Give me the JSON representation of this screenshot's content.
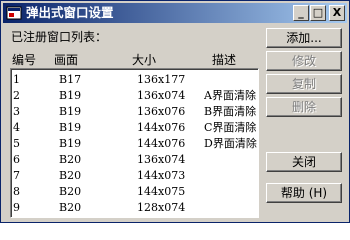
{
  "window": {
    "title": "弹出式窗口设置",
    "minimize": "_",
    "maximize": "□",
    "close": "X"
  },
  "list_label": "已注册窗口列表：",
  "columns": [
    "编号",
    "画面",
    "大小",
    "描述"
  ],
  "rows": [
    [
      "1",
      "B17",
      "136x177",
      ""
    ],
    [
      "2",
      "B19",
      "136x074",
      "A界面清除"
    ],
    [
      "3",
      "B19",
      "136x076",
      "B界面清除"
    ],
    [
      "4",
      "B19",
      "144x076",
      "C界面清除"
    ],
    [
      "5",
      "B19",
      "144x076",
      "D界面清除"
    ],
    [
      "6",
      "B20",
      "136x074",
      ""
    ],
    [
      "7",
      "B20",
      "144x073",
      ""
    ],
    [
      "8",
      "B20",
      "144x075",
      ""
    ],
    [
      "9",
      "B20",
      "128x074",
      ""
    ]
  ],
  "buttons": {
    "add": "添加...",
    "modify": "修改",
    "copy": "复制",
    "delete": "删除",
    "close": "关闭",
    "help": "帮助 (H)"
  }
}
